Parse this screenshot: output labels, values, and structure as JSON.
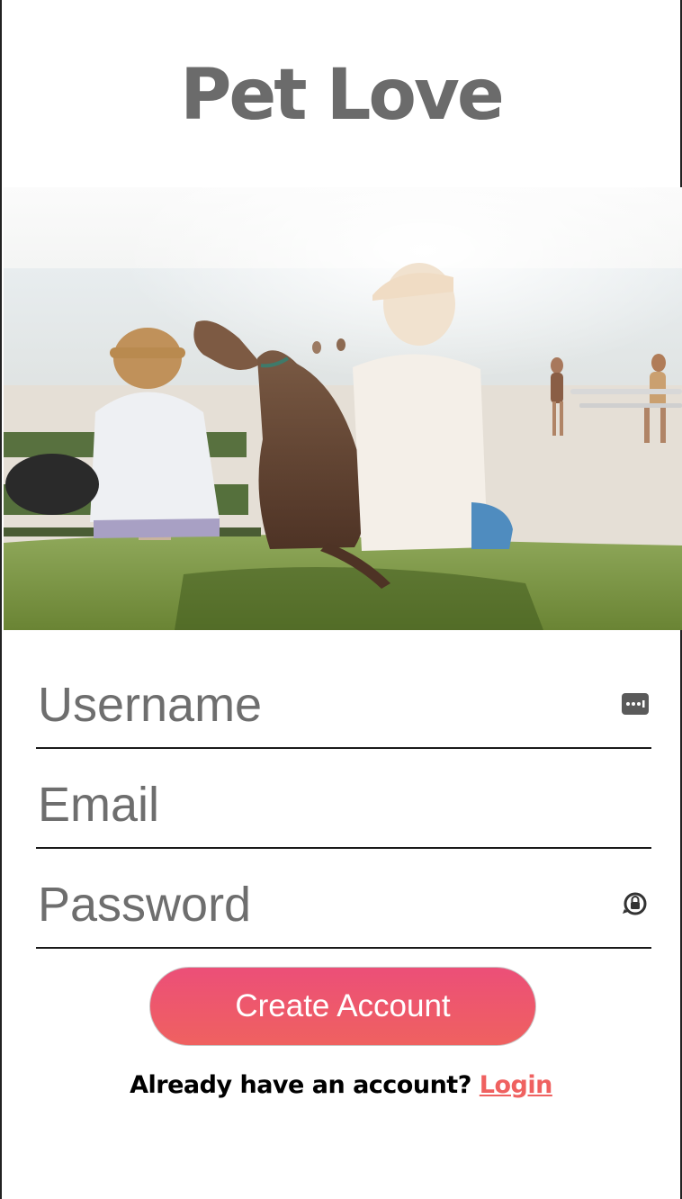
{
  "app": {
    "title": "Pet Love"
  },
  "hero": {
    "icon": "beach-photo-people-with-dog"
  },
  "form": {
    "username_placeholder": "Username",
    "email_placeholder": "Email",
    "password_placeholder": "Password",
    "username_icon": "keyboard-autofill-icon",
    "password_icon": "password-manager-icon"
  },
  "actions": {
    "create_account_label": "Create Account",
    "prompt_text": "Already have an account?",
    "login_link": "Login"
  },
  "colors": {
    "title": "#6b6b6b",
    "button_gradient_start": "#ec4f78",
    "button_gradient_end": "#ef6160",
    "link": "#ef6160",
    "underline": "#1a1a1a"
  }
}
